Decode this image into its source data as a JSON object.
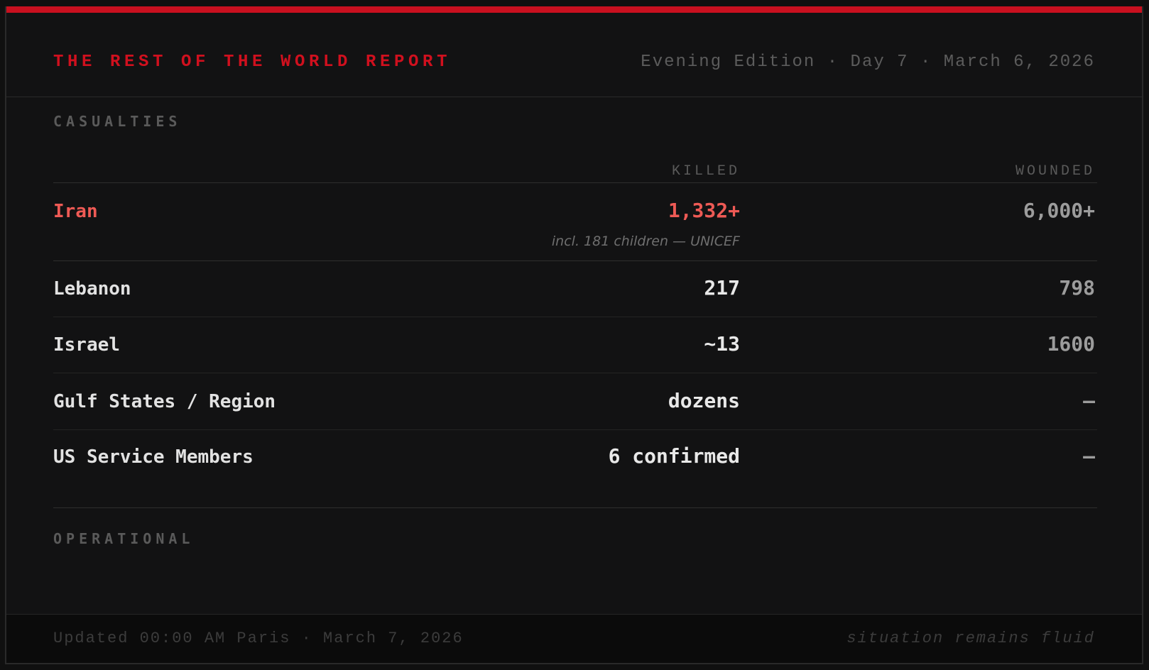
{
  "header": {
    "title": "THE REST OF THE WORLD REPORT",
    "edition": "Evening Edition · Day 7 · March 6, 2026"
  },
  "casualties": {
    "section_label": "CASUALTIES",
    "columns": {
      "killed": "KILLED",
      "wounded": "WOUNDED"
    },
    "rows": [
      {
        "label": "Iran",
        "killed": "1,332+",
        "note": "incl. 181 children — UNICEF",
        "wounded": "6,000+"
      },
      {
        "label": "Lebanon",
        "killed": "217",
        "wounded": "798"
      },
      {
        "label": "Israel",
        "killed": "~13",
        "wounded": "1600"
      },
      {
        "label": "Gulf States / Region",
        "killed": "dozens",
        "wounded": "—"
      },
      {
        "label": "US Service Members",
        "killed": "6 confirmed",
        "wounded": "—"
      }
    ]
  },
  "operational": {
    "section_label": "OPERATIONAL"
  },
  "footer": {
    "updated": "Updated 00:00 AM Paris · March 7, 2026",
    "status": "situation remains fluid"
  },
  "colors": {
    "accent": "#c8101f",
    "highlight": "#ee5a55",
    "background": "#121213"
  }
}
